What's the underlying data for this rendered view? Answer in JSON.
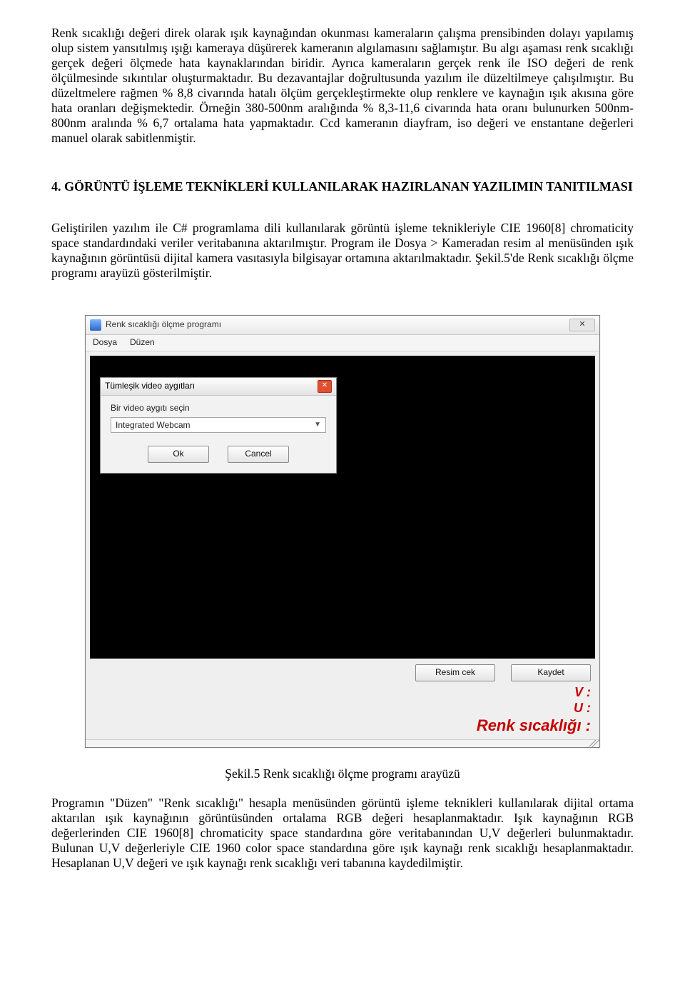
{
  "paragraphs": {
    "p1": "Renk sıcaklığı değeri direk olarak ışık kaynağından okunması kameraların çalışma prensibinden dolayı yapılamış olup sistem yansıtılmış ışığı kameraya düşürerek kameranın algılamasını sağlamıştır. Bu algı aşaması renk sıcaklığı gerçek değeri ölçmede hata kaynaklarından biridir. Ayrıca kameraların gerçek renk ile ISO değeri de renk ölçülmesinde sıkıntılar oluşturmaktadır. Bu dezavantajlar doğrultusunda yazılım ile düzeltilmeye çalışılmıştır. Bu düzeltmelere rağmen % 8,8 civarında hatalı ölçüm gerçekleştirmekte olup renklere ve kaynağın ışık akısına göre hata oranları değişmektedir. Örneğin 380-500nm aralığında % 8,3-11,6 civarında hata oranı bulunurken 500nm-800nm aralında % 6,7 ortalama hata yapmaktadır. Ccd kameranın diayfram, iso değeri ve enstantane değerleri manuel olarak sabitlenmiştir.",
    "heading": "4. GÖRÜNTÜ İŞLEME TEKNİKLERİ KULLANILARAK HAZIRLANAN YAZILIMIN TANITILMASI",
    "p2": "Geliştirilen yazılım ile C# programlama dili kullanılarak görüntü işleme teknikleriyle CIE 1960[8] chromaticity space standardındaki veriler veritabanına aktarılmıştır. Program ile Dosya > Kameradan resim al menüsünden ışık kaynağının görüntüsü dijital kamera vasıtasıyla bilgisayar ortamına aktarılmaktadır. Şekil.5'de Renk sıcaklığı ölçme programı arayüzü gösterilmiştir.",
    "caption": "Şekil.5 Renk sıcaklığı ölçme programı arayüzü",
    "p3": "Programın \"Düzen\" \"Renk sıcaklığı\" hesapla menüsünden görüntü işleme teknikleri kullanılarak dijital ortama aktarılan ışık kaynağının görüntüsünden ortalama RGB değeri hesaplanmaktadır. Işık kaynağının RGB değerlerinden CIE 1960[8] chromaticity space standardına göre veritabanından U,V değerleri bulunmaktadır. Bulunan U,V değerleriyle CIE 1960 color space standardına göre ışık kaynağı renk sıcaklığı hesaplanmaktadır. Hesaplanan U,V değeri ve ışık kaynağı renk sıcaklığı veri tabanına kaydedilmiştir."
  },
  "app": {
    "title": "Renk sıcaklığı ölçme programı",
    "close": "✕",
    "menu": {
      "file": "Dosya",
      "edit": "Düzen"
    },
    "dialog": {
      "title": "Tümleşik video aygıtları",
      "label": "Bir video aygıtı seçin",
      "selected": "Integrated Webcam",
      "ok": "Ok",
      "cancel": "Cancel",
      "close": "✕"
    },
    "buttons": {
      "capture": "Resim cek",
      "save": "Kaydet"
    },
    "readout": {
      "v": "V :",
      "u": "U :",
      "temp": "Renk sıcaklığı :"
    }
  }
}
